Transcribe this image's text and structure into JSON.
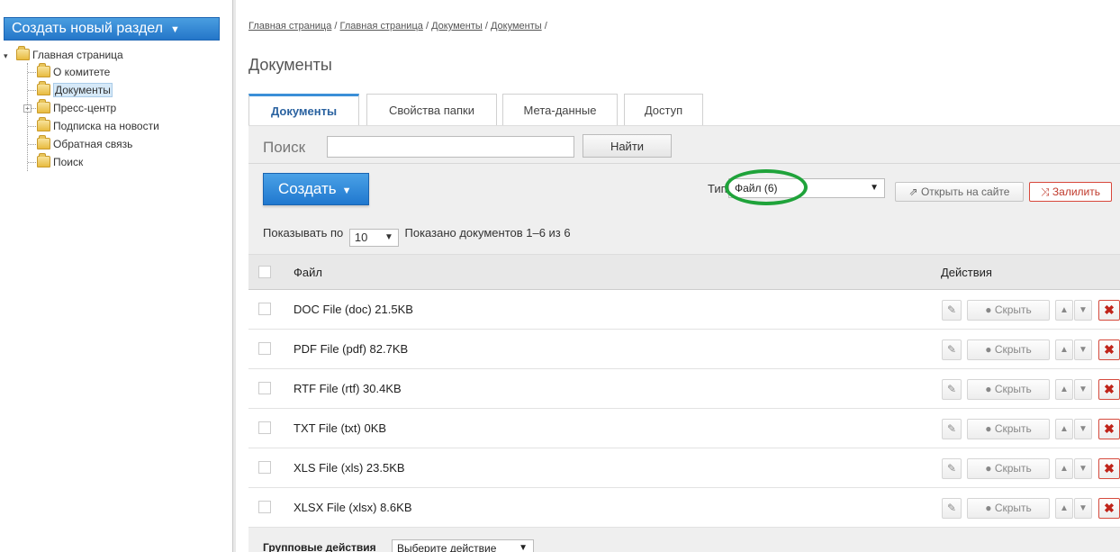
{
  "sidebar": {
    "create_section_label": "Создать новый раздел",
    "tree": {
      "root_label": "Главная страница",
      "items": [
        {
          "label": "О комитете"
        },
        {
          "label": "Документы",
          "selected": true
        },
        {
          "label": "Пресс-центр",
          "expandable": true
        },
        {
          "label": "Подписка на новости"
        },
        {
          "label": "Обратная связь"
        },
        {
          "label": "Поиск"
        }
      ]
    }
  },
  "breadcrumb": {
    "items": [
      "Главная страница",
      "Главная страница",
      "Документы",
      "Документы"
    ],
    "separator": "/"
  },
  "page_title": "Документы",
  "tabs": [
    {
      "label": "Документы",
      "active": true
    },
    {
      "label": "Свойства папки"
    },
    {
      "label": "Мета-данные"
    },
    {
      "label": "Доступ"
    }
  ],
  "search": {
    "label": "Поиск",
    "value": "",
    "button_label": "Найти"
  },
  "toolbar": {
    "create_label": "Создать",
    "type_label": "Тип",
    "type_value": "Файл (6)",
    "open_site_label": "Открыть на сайте",
    "fill_label": "Залилить"
  },
  "paging": {
    "show_per_label": "Показывать по",
    "per_page": "10",
    "shown_text": "Показано документов 1–6 из 6"
  },
  "table": {
    "col_file": "Файл",
    "col_actions": "Действия",
    "hide_label": "Скрыть",
    "rows": [
      {
        "file": "DOC File (doc) 21.5KB"
      },
      {
        "file": "PDF File (pdf) 82.7KB"
      },
      {
        "file": "RTF File (rtf) 30.4KB"
      },
      {
        "file": "TXT File (txt) 0KB"
      },
      {
        "file": "XLS File (xls) 23.5KB"
      },
      {
        "file": "XLSX File (xlsx) 8.6KB"
      }
    ]
  },
  "group_actions": {
    "label": "Групповые действия",
    "select_value": "Выберите действие"
  },
  "colors": {
    "accent_blue": "#2a7fd4",
    "highlight_green": "#1fa33a",
    "danger_red": "#d64b3e"
  }
}
